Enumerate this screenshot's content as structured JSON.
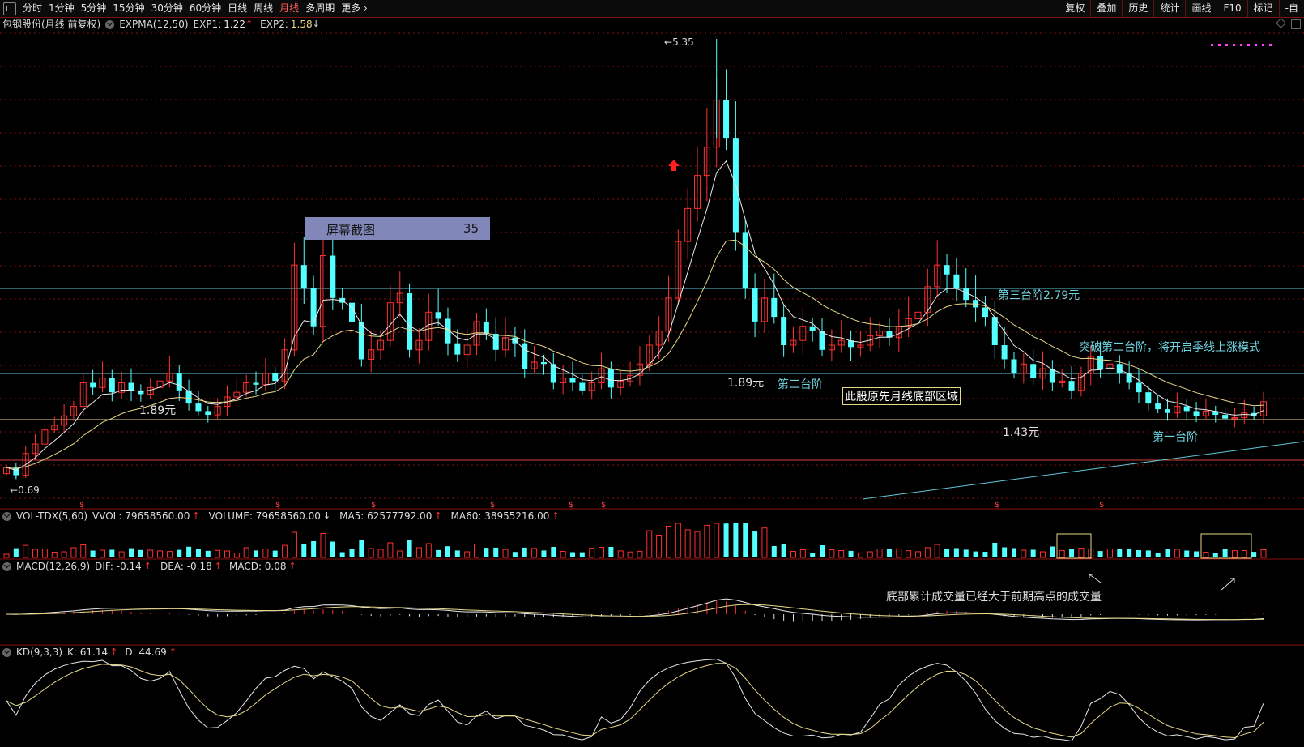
{
  "toolbar": {
    "periods": [
      "分时",
      "1分钟",
      "5分钟",
      "15分钟",
      "30分钟",
      "60分钟",
      "日线",
      "周线",
      "月线",
      "多周期",
      "更多"
    ],
    "active_period": "月线",
    "right_buttons": [
      "复权",
      "叠加",
      "历史",
      "统计",
      "画线",
      "F10",
      "标记",
      "-自"
    ]
  },
  "main": {
    "stock_title": "包钢股份(月线 前复权)",
    "indicator": "EXPMA(12,50)",
    "exp1_label": "EXP1:",
    "exp1_value": "1.22",
    "exp2_label": "EXP2:",
    "exp2_value": "1.58",
    "high_label": "5.35",
    "low_label": "0.69",
    "overlay_box": {
      "label": "屏幕截图",
      "number": "35"
    }
  },
  "annotations": {
    "step3": "第三台阶2.79元",
    "breakout": "突破第二台阶，将开启季线上涨模式",
    "price_189_left": "1.89元",
    "price_189_mid": "1.89元",
    "step2": "第二台阶",
    "bottom_region": "此股原先月线底部区域",
    "price_143": "1.43元",
    "step1": "第一台阶",
    "volume_note": "底部累计成交量已经大于前期高点的成交量"
  },
  "vol": {
    "name": "VOL-TDX(5,60)",
    "vvol": "VVOL: 79658560.00",
    "volume": "VOLUME: 79658560.00",
    "ma5": "MA5: 62577792.00",
    "ma60": "MA60: 38955216.00"
  },
  "macd": {
    "name": "MACD(12,26,9)",
    "dif": "DIF: -0.14",
    "dea": "DEA: -0.18",
    "macd": "MACD: 0.08"
  },
  "kd": {
    "name": "KD(9,3,3)",
    "k": "K: 61.14",
    "d": "D: 44.69"
  },
  "colors": {
    "up": "#ff3030",
    "down": "#54ffff",
    "ma_white": "#e8e8e8",
    "ma_yellow": "#e8d88a",
    "level_cyan": "#5fc8d8",
    "grid_red": "#8a1010"
  }
}
